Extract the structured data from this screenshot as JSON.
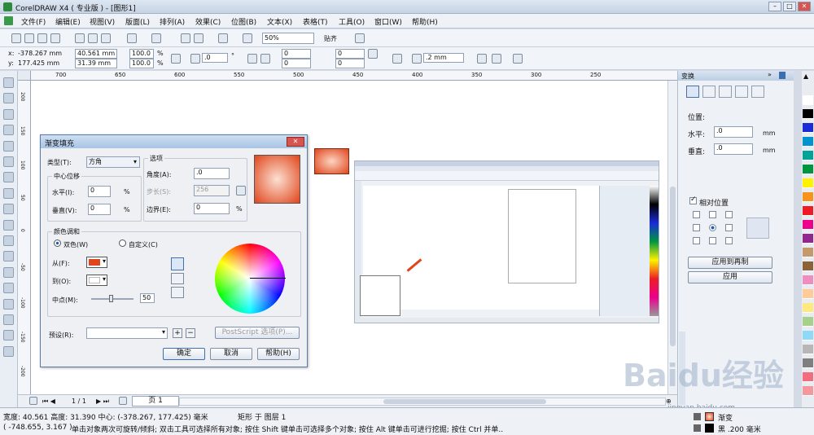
{
  "window": {
    "title": "CorelDRAW X4 ( 专业版 ) - [图形1]"
  },
  "menu": [
    "文件(F)",
    "编辑(E)",
    "视图(V)",
    "版面(L)",
    "排列(A)",
    "效果(C)",
    "位图(B)",
    "文本(X)",
    "表格(T)",
    "工具(O)",
    "窗口(W)",
    "帮助(H)"
  ],
  "toolbar": {
    "zoom": "50%",
    "snap": "贴齐"
  },
  "propbar": {
    "x": "-378.267 mm",
    "y": "177.425 mm",
    "w": "40.561 mm",
    "h": "31.39 mm",
    "sx": "100.0",
    "sy": "100.0",
    "pct": "%",
    "angle": ".0",
    "deg": "°",
    "c1": "0",
    "c2": "0",
    "c3": "0",
    "c4": "0",
    "outline": ".2 mm"
  },
  "ruler": {
    "h": [
      "700",
      "650",
      "600",
      "550",
      "500",
      "450",
      "400",
      "350",
      "300",
      "250"
    ],
    "v": [
      "200",
      "150",
      "100",
      "50",
      "0",
      "-50",
      "-100",
      "-150",
      "-200"
    ]
  },
  "dialog": {
    "title": "渐变填充",
    "type_label": "类型(T):",
    "type_value": "方角",
    "center_label": "中心位移",
    "hx_label": "水平(I):",
    "hx_value": "0",
    "hy_label": "垂直(V):",
    "hy_value": "0",
    "opts_label": "选项",
    "angle_label": "角度(A):",
    "angle_value": ".0",
    "steps_label": "步长(S):",
    "steps_value": "256",
    "edge_label": "边界(E):",
    "edge_value": "0",
    "pct": "%",
    "blend_label": "颜色调和",
    "two_color": "双色(W)",
    "custom": "自定义(C)",
    "from_label": "从(F):",
    "to_label": "到(O):",
    "mid_label": "中点(M):",
    "mid_value": "50",
    "preset_label": "预设(R):",
    "postscript": "PostScript 选项(P)...",
    "ok": "确定",
    "cancel": "取消",
    "help": "帮助(H)",
    "from_color": "#e0451b",
    "to_color": "#ffffff"
  },
  "docker": {
    "title": "变换",
    "position": "位置:",
    "h_label": "水平:",
    "h_value": ".0",
    "v_label": "垂直:",
    "v_value": ".0",
    "unit": "mm",
    "relative": "相对位置",
    "apply_dup": "应用到再制",
    "apply": "应用"
  },
  "pagenav": {
    "pos": "1 / 1",
    "tab": "页 1"
  },
  "status": {
    "line1": "宽度: 40.561 高度: 31.390 中心: (-378.267, 177.425) 毫米",
    "layer": "矩形 于 图层 1",
    "line2_coord": "( -748.655, 3.167 )",
    "line2_hint": "单击对象两次可旋转/倾斜; 双击工具可选择所有对象; 按住 Shift 键单击可选择多个对象; 按住 Alt 键单击可进行挖掘; 按住 Ctrl 并单...",
    "fill": "渐变",
    "outline": "黑 .200 毫米"
  },
  "watermark": {
    "text": "Baidu经验",
    "url": "jingyan.baidu.com"
  },
  "palette": [
    "#ffffff",
    "#000000",
    "#1b2bd8",
    "#0093d0",
    "#00a39a",
    "#00963f",
    "#fff200",
    "#f7941d",
    "#ed1c24",
    "#ec008c",
    "#92278f",
    "#c49a6c",
    "#8c6239",
    "#ee8ec0",
    "#ffcc99",
    "#ffe97f",
    "#a7d08c",
    "#8ed8f8",
    "#b7b7b7",
    "#7f7f7f",
    "#f26d7d",
    "#f5989d"
  ]
}
